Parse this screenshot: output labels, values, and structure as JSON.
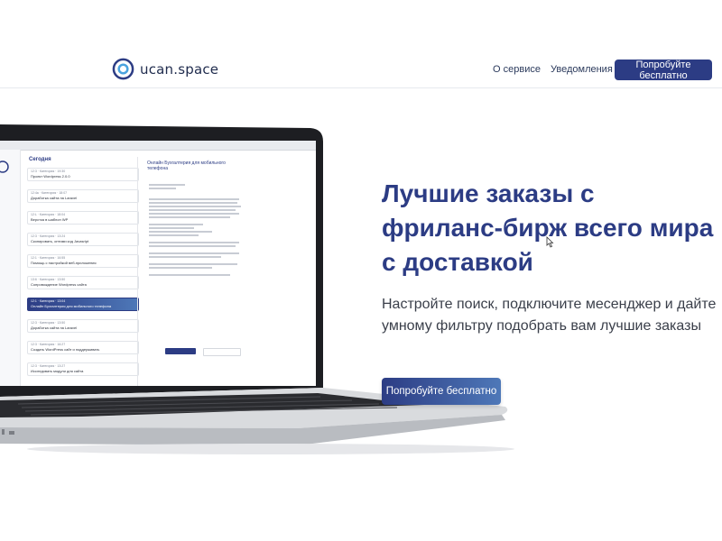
{
  "header": {
    "brand": "ucan.space",
    "nav": {
      "about": "О сервисе",
      "notifications": "Уведомления"
    },
    "cta": "Попробуйте бесплатно"
  },
  "hero": {
    "title_lines": [
      "Лучшие заказы с",
      "фриланс-бирж всего мира",
      "с доставкой"
    ],
    "subtitle": "Настройте поиск, подключите месенджер и дайте умному фильтру подобрать вам лучшие заказы",
    "cta": "Попробуйте бесплатно"
  },
  "screen": {
    "heading": "Сегодня",
    "detail_title": "Онлайн Бухгалтерия для мобильного телефона",
    "items": [
      {
        "meta": "12:3 · Категория · 19:30",
        "text": "Проект Wordpress 2.0.0"
      },
      {
        "meta": "12:4a · Категория · 18:07",
        "text": "Доработка сайта на Laravel"
      },
      {
        "meta": "12:L · Категория · 18:04",
        "text": "Верстка в шаблон WP"
      },
      {
        "meta": "12:3 · Категория · 13:24",
        "text": "Скопировать, оптими код Javasript"
      },
      {
        "meta": "12:1 · Категория · 16:55",
        "text": "Помощь с настройкой веб-приложения"
      },
      {
        "meta": "13:6 · Категория · 13:50",
        "text": "Сопровождение Wordpress сайта"
      },
      {
        "meta": "12:1 · Категория · 13:04",
        "text": "Онлайн Бухгалтерия для мобильного телефона"
      },
      {
        "meta": "12:3 · Категория · 13:50",
        "text": "Доработка сайта на Laravel"
      },
      {
        "meta": "12:3 · Категория · 16:27",
        "text": "Создать WordPress сайт и поддерживать"
      },
      {
        "meta": "12:3 · Категория · 13:27",
        "text": "Исследовать модули для сайта"
      }
    ],
    "active_index": 6,
    "accent": "#2c3c84"
  },
  "colors": {
    "brand": "#2c3c84",
    "accent_light": "#4e78b8"
  }
}
